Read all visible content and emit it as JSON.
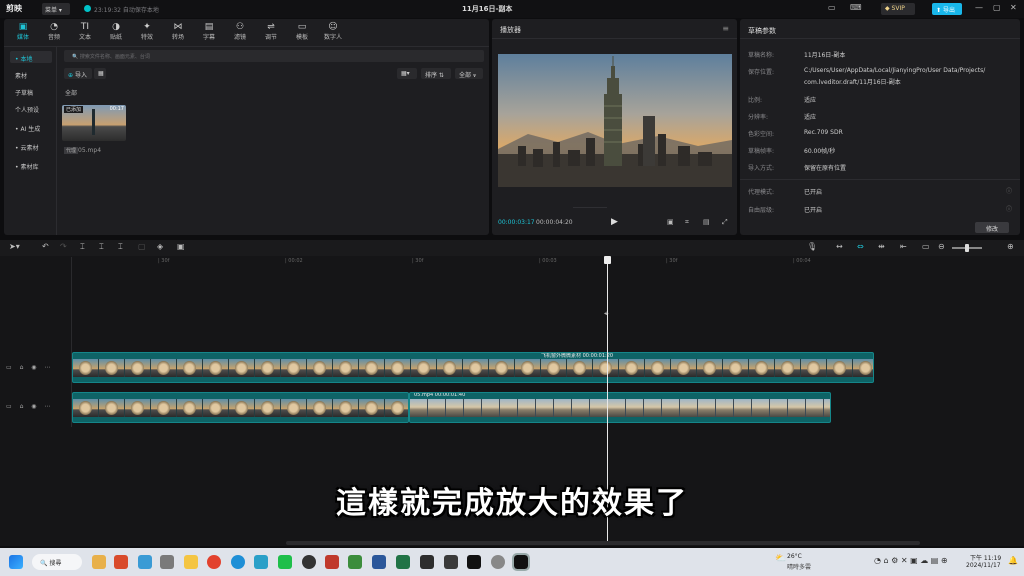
{
  "titlebar": {
    "app_name": "剪映",
    "menu_label": "菜单",
    "autosave": "23:19:32 自动保存本地",
    "doc_title": "11月16日-副本",
    "svip": "SVIP",
    "export_label": "导出"
  },
  "toolbar": {
    "tabs": [
      {
        "label": "媒体",
        "icon": "media-icon"
      },
      {
        "label": "音频",
        "icon": "audio-icon"
      },
      {
        "label": "文本",
        "icon": "text-icon"
      },
      {
        "label": "贴纸",
        "icon": "sticker-icon"
      },
      {
        "label": "特效",
        "icon": "effects-icon"
      },
      {
        "label": "转场",
        "icon": "transition-icon"
      },
      {
        "label": "字幕",
        "icon": "subtitle-icon"
      },
      {
        "label": "滤镜",
        "icon": "filter-icon"
      },
      {
        "label": "调节",
        "icon": "adjust-icon"
      },
      {
        "label": "模板",
        "icon": "template-icon"
      },
      {
        "label": "数字人",
        "icon": "digital-human-icon"
      }
    ]
  },
  "sidebar": {
    "items": [
      {
        "label": "• 本地",
        "active": true
      },
      {
        "label": "素材"
      },
      {
        "label": "子草稿"
      },
      {
        "label": "个人预设"
      },
      {
        "label": "• AI 生成"
      },
      {
        "label": "• 云素材"
      },
      {
        "label": "• 素材库"
      }
    ]
  },
  "media": {
    "search_placeholder": "搜索文件名称、画面元素、台词",
    "import_label": "导入",
    "sort_label": "排序",
    "filter_label": "全部",
    "section_label": "全部",
    "thumb": {
      "badge": "已添加",
      "duration": "00:17",
      "name": "05.mp4"
    }
  },
  "player": {
    "title": "播放器",
    "current_time": "00:00:03:17",
    "total_time": "00:00:04:20"
  },
  "params": {
    "title": "草稿参数",
    "rows": [
      {
        "k": "草稿名称:",
        "v": "11月16日-副本"
      },
      {
        "k": "保存位置:",
        "v": "C:/Users/User/AppData/Local/JianyingPro/User Data/Projects/"
      },
      {
        "k": "",
        "v": "com.lveditor.draft/11月16日-副本"
      },
      {
        "k": "比例:",
        "v": "适应"
      },
      {
        "k": "分辨率:",
        "v": "适应"
      },
      {
        "k": "色彩空间:",
        "v": "Rec.709 SDR"
      },
      {
        "k": "草稿帧率:",
        "v": "60.00帧/秒"
      },
      {
        "k": "导入方式:",
        "v": "保留在原有位置"
      },
      {
        "k": "代理模式:",
        "v": "已开启"
      },
      {
        "k": "自由层级:",
        "v": "已开启"
      }
    ],
    "modify_label": "修改"
  },
  "timeline": {
    "ruler": [
      "| 30f",
      "| 00:02",
      "| 30f",
      "| 00:03",
      "| 30f",
      "| 00:04"
    ],
    "clip_top_label": "飞机窗外微微素材  00:00:01:20",
    "clip_bottom_label": "05.mp4  00:00:01:40"
  },
  "subtitle_text": "這樣就完成放大的效果了",
  "taskbar": {
    "search_label": "搜尋",
    "weather_temp": "26°C",
    "weather_desc": "晴時多雲",
    "time": "下午 11:19",
    "date": "2024/11/17"
  },
  "colors": {
    "accent": "#1ec4d6",
    "clip": "#0e6366",
    "export": "#19b7ea"
  }
}
